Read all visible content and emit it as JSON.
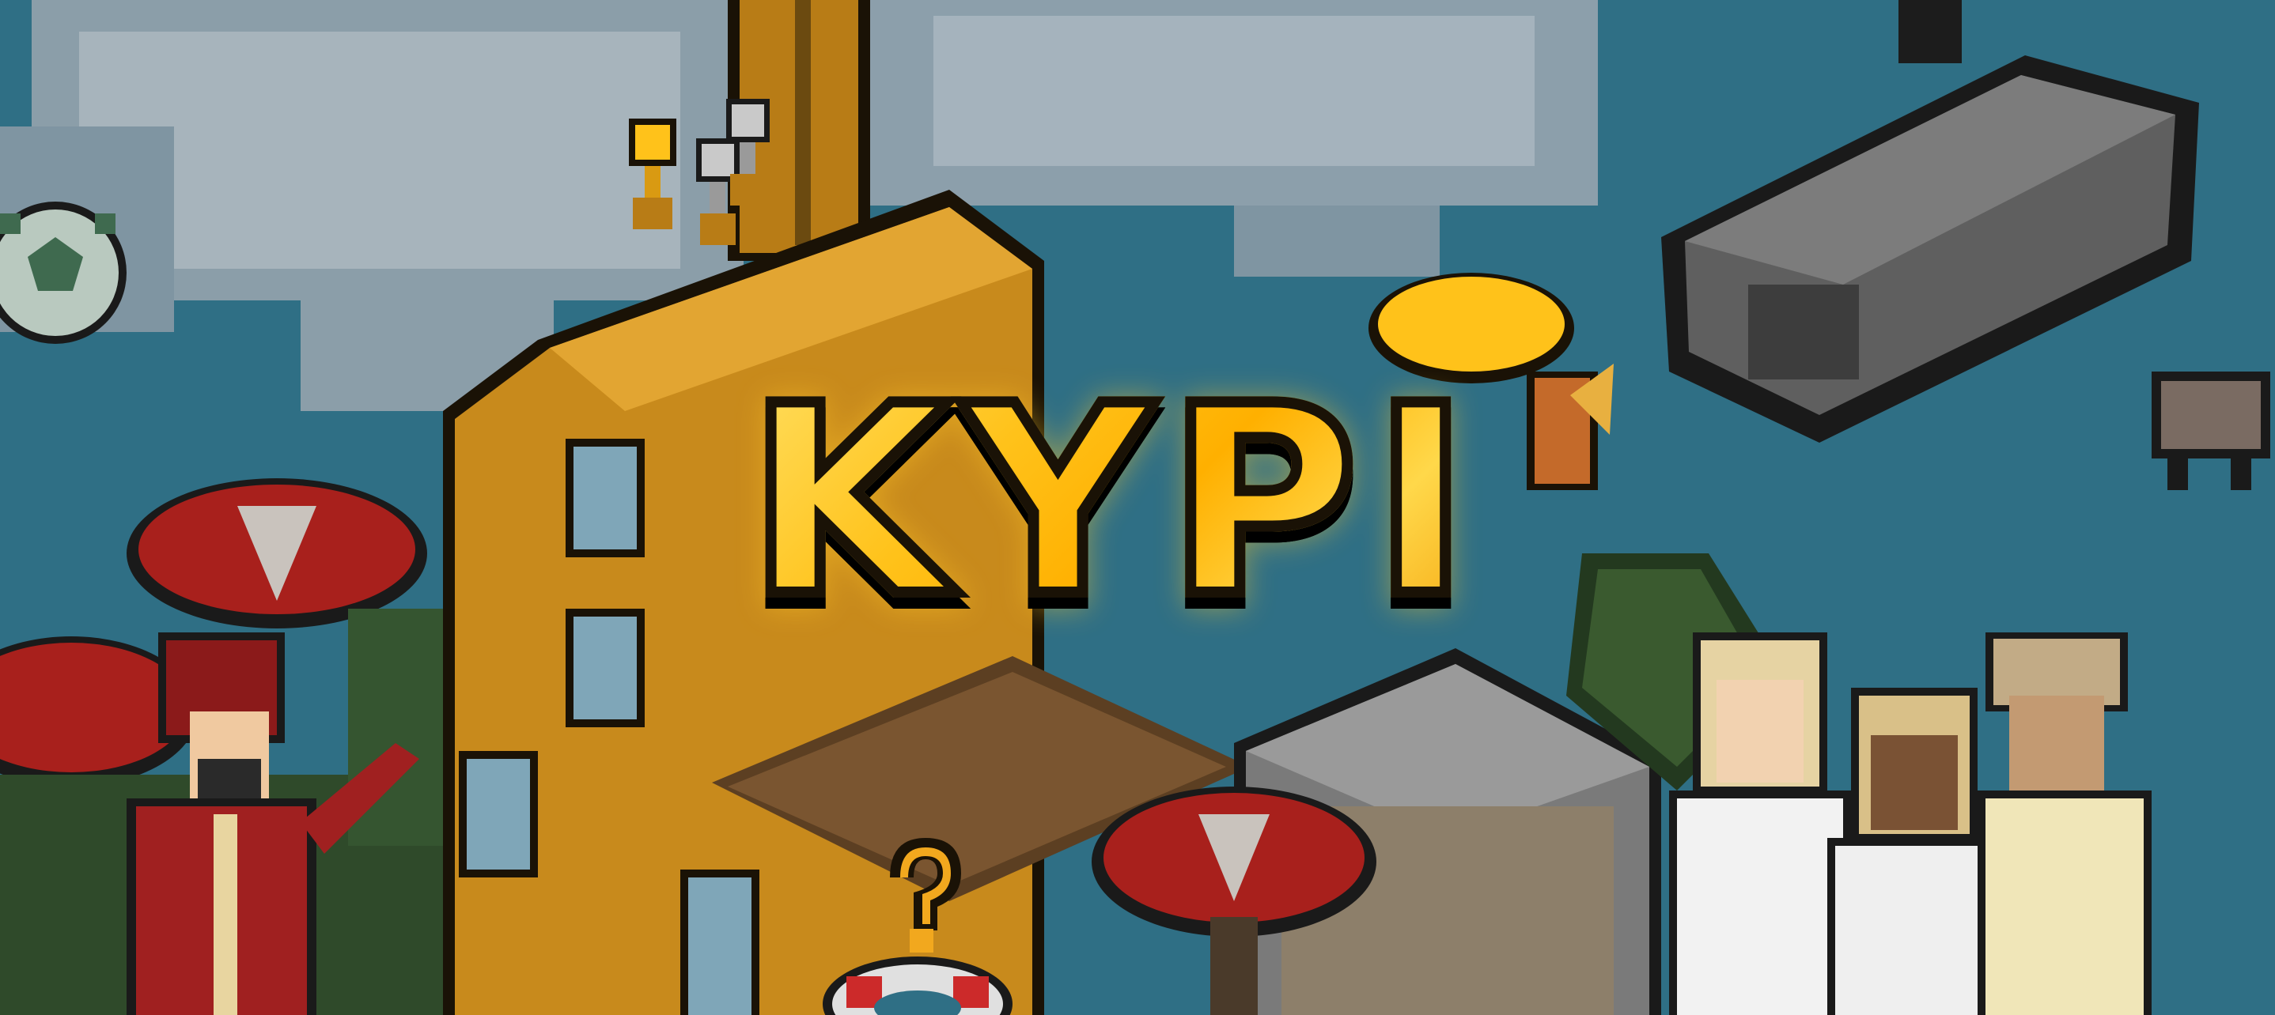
{
  "logo": {
    "text": "KYPI"
  },
  "colors": {
    "sky": "#2f6f85",
    "cloud": "#9aa9b3",
    "gold": "#ffc21a",
    "outline": "#1a1206",
    "building": "#c88a1c",
    "mushroom": "#a8201c",
    "gray_block": "#5a5a5a"
  },
  "icons": [
    "trophy-gold-icon",
    "trophy-silver-icon",
    "soccer-ball-icon",
    "question-mark-icon",
    "life-ring-icon",
    "hard-hat-icon",
    "dog-icon"
  ]
}
